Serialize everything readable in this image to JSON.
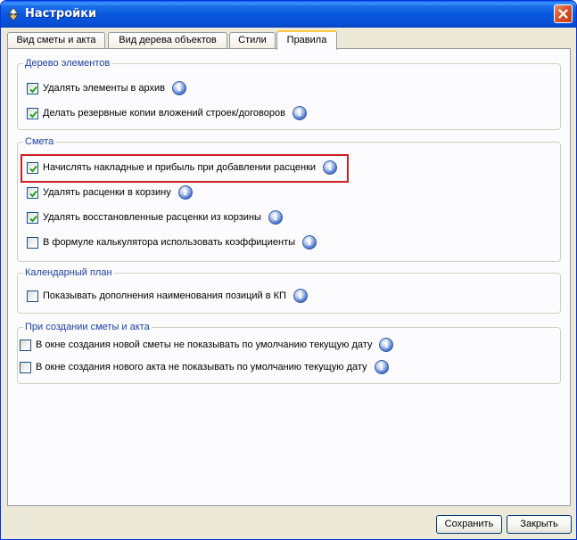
{
  "window": {
    "title": "Настройки"
  },
  "tabs": [
    {
      "label": "Вид сметы и акта",
      "active": false
    },
    {
      "label": "Вид дерева объектов",
      "active": false
    },
    {
      "label": "Стили",
      "active": false
    },
    {
      "label": "Правила",
      "active": true
    }
  ],
  "groups": {
    "tree": {
      "title": "Дерево элементов",
      "items": [
        {
          "label": "Удалять элементы в архив",
          "checked": true
        },
        {
          "label": "Делать резервные копии вложений строек/договоров",
          "checked": true
        }
      ]
    },
    "estimate": {
      "title": "Смета",
      "items": [
        {
          "label": "Начислять накладные и прибыль при добавлении расценки",
          "checked": true
        },
        {
          "label": "Удалять расценки в корзину",
          "checked": true
        },
        {
          "label": "Удалять восстановленные расценки из корзины",
          "checked": true
        },
        {
          "label": "В формуле калькулятора использовать коэффициенты",
          "checked": false
        }
      ]
    },
    "calendar": {
      "title": "Календарный план",
      "items": [
        {
          "label": "Показывать дополнения наименования позиций в КП",
          "checked": false
        }
      ]
    },
    "creation": {
      "title": "При создании сметы и акта",
      "items": [
        {
          "label": "В окне создания новой сметы не показывать по умолчанию текущую дату",
          "checked": false
        },
        {
          "label": "В окне создания нового акта не показывать по умолчанию текущую дату",
          "checked": false
        }
      ]
    }
  },
  "footer": {
    "save_label": "Сохранить",
    "close_label": "Закрыть"
  },
  "colors": {
    "titlebar": "#0855dd",
    "window_bg": "#ece9d8",
    "group_title": "#1a3f9e",
    "highlight": "#cc1f1f",
    "check": "#21a121"
  },
  "icons": {
    "app": "arrows-icon",
    "close": "close-icon",
    "info": "info-icon",
    "check": "checkmark-icon"
  }
}
